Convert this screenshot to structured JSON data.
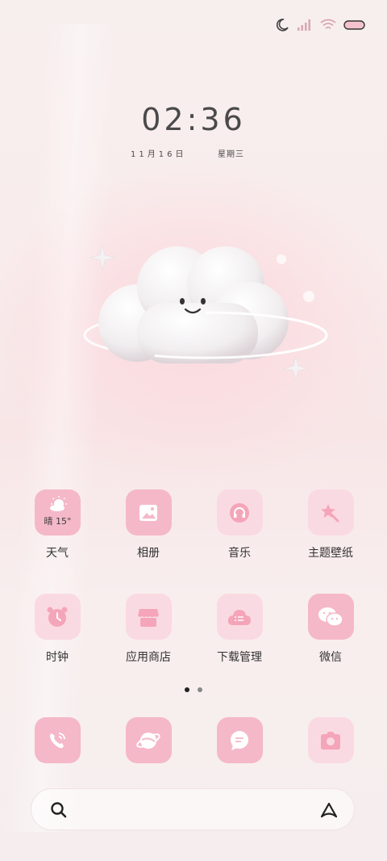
{
  "status_bar": {
    "icons": [
      "moon-icon",
      "signal-icon",
      "wifi-icon",
      "battery-icon"
    ]
  },
  "clock": {
    "time": "02:36",
    "date": "11月16日",
    "weekday": "星期三"
  },
  "apps_row1": [
    {
      "label": "天气",
      "icon": "weather-icon",
      "weather": "晴 15°"
    },
    {
      "label": "相册",
      "icon": "gallery-icon"
    },
    {
      "label": "音乐",
      "icon": "headphones-icon"
    },
    {
      "label": "主题壁纸",
      "icon": "theme-star-icon"
    }
  ],
  "apps_row2": [
    {
      "label": "时钟",
      "icon": "alarm-clock-icon"
    },
    {
      "label": "应用商店",
      "icon": "store-icon"
    },
    {
      "label": "下载管理",
      "icon": "cloud-download-icon"
    },
    {
      "label": "微信",
      "icon": "wechat-icon"
    }
  ],
  "dock": [
    {
      "icon": "phone-icon"
    },
    {
      "icon": "browser-planet-icon"
    },
    {
      "icon": "message-icon"
    },
    {
      "icon": "camera-icon"
    }
  ],
  "page_indicator": {
    "pages": 2,
    "current": 1
  },
  "search": {
    "icons": [
      "search-icon",
      "assistant-icon"
    ]
  },
  "colors": {
    "icon_pink": "#f5b8c8",
    "icon_light": "#fadae2",
    "text": "#333333"
  }
}
